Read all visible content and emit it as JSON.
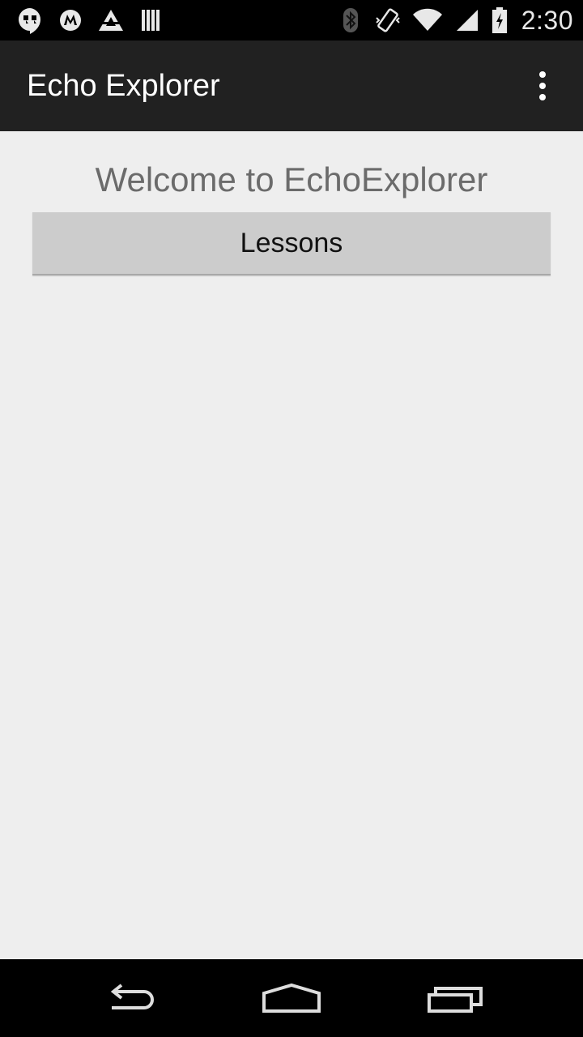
{
  "status_bar": {
    "time": "2:30",
    "left_icons": [
      "hangouts-icon",
      "motorola-icon",
      "triangle-logo-icon",
      "barcode-icon"
    ],
    "right_icons": [
      "bluetooth-icon",
      "vibrate-icon",
      "wifi-icon",
      "signal-icon",
      "battery-charging-icon"
    ]
  },
  "action_bar": {
    "title": "Echo Explorer",
    "overflow_icon": "overflow-menu-icon"
  },
  "main": {
    "welcome_text": "Welcome to EchoExplorer",
    "lessons_button_label": "Lessons"
  },
  "nav_bar": {
    "buttons": [
      "back-icon",
      "home-icon",
      "recents-icon"
    ]
  },
  "colors": {
    "action_bar_bg": "#212121",
    "content_bg": "#eeeeee",
    "button_bg": "#cccccc",
    "welcome_text": "#6b6b6b"
  }
}
